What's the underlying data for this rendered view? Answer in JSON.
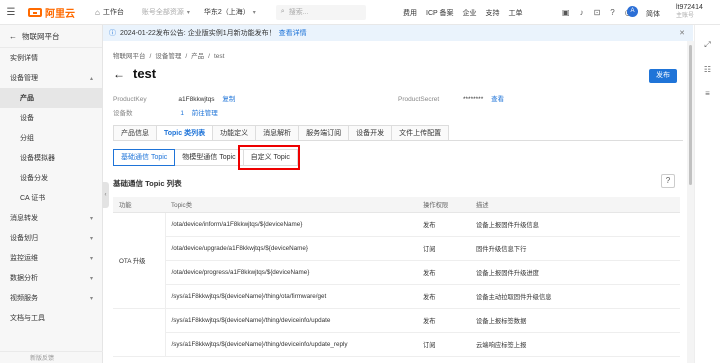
{
  "topbar": {
    "logo_text": "阿里云",
    "workbench": "工作台",
    "resource_group": "账号全部资源",
    "region": "华东2（上海）",
    "search_placeholder": "搜索...",
    "nav": [
      "费用",
      "ICP 备案",
      "企业",
      "支持",
      "工单"
    ],
    "avatar_initial": "A",
    "language": "简体",
    "user_name": "lt972414",
    "user_sub": "主账号"
  },
  "sidebar": {
    "header": "物联网平台",
    "items": [
      {
        "label": "实例详情",
        "level": 0,
        "expandable": false
      },
      {
        "label": "设备管理",
        "level": 0,
        "expandable": true,
        "expanded": true
      },
      {
        "label": "产品",
        "level": 1,
        "active": true
      },
      {
        "label": "设备",
        "level": 1
      },
      {
        "label": "分组",
        "level": 1
      },
      {
        "label": "设备模拟器",
        "level": 1
      },
      {
        "label": "设备分发",
        "level": 1
      },
      {
        "label": "CA 证书",
        "level": 1
      },
      {
        "label": "消息转发",
        "level": 0,
        "expandable": true
      },
      {
        "label": "设备划归",
        "level": 0,
        "expandable": true
      },
      {
        "label": "监控运维",
        "level": 0,
        "expandable": true
      },
      {
        "label": "数据分析",
        "level": 0,
        "expandable": true
      },
      {
        "label": "视频服务",
        "level": 0,
        "expandable": true
      },
      {
        "label": "文档与工具",
        "level": 0,
        "expandable": false
      }
    ],
    "footer": "新版反馈"
  },
  "notice": {
    "text": "2024-01-22发布公告: 企业版实例1月新功能发布！",
    "link": "查看详情"
  },
  "breadcrumb": [
    "物联网平台",
    "/",
    "设备管理",
    "/",
    "产品",
    "/",
    "test"
  ],
  "page": {
    "title": "test",
    "publish_label": "发布",
    "product_key_label": "ProductKey",
    "product_key_value": "a1F8kkwjtqs",
    "copy_label": "复制",
    "product_secret_label": "ProductSecret",
    "product_secret_value": "********",
    "view_label": "查看",
    "device_count_label": "设备数",
    "device_count_value": "1",
    "manage_label": "前往管理"
  },
  "tabs": [
    "产品信息",
    "Topic 类列表",
    "功能定义",
    "消息解析",
    "服务端订阅",
    "设备开发",
    "文件上传配置"
  ],
  "active_tab": 1,
  "subtabs": [
    "基础通信 Topic",
    "物模型通信 Topic",
    "自定义 Topic"
  ],
  "active_subtab": 0,
  "section_title": "基础通信 Topic 列表",
  "help_label": "?",
  "table": {
    "headers": [
      "功能",
      "Topic类",
      "操作权限",
      "描述"
    ],
    "group_label": "OTA 升级",
    "rows": [
      {
        "topic": "/ota/device/inform/a1F8kkwjtqs/${deviceName}",
        "perm": "发布",
        "desc": "设备上报固件升级信息"
      },
      {
        "topic": "/ota/device/upgrade/a1F8kkwjtqs/${deviceName}",
        "perm": "订阅",
        "desc": "固件升级信息下行"
      },
      {
        "topic": "/ota/device/progress/a1F8kkwjtqs/${deviceName}",
        "perm": "发布",
        "desc": "设备上报固件升级进度"
      },
      {
        "topic": "/sys/a1F8kkwjtqs/${deviceName}/thing/ota/firmware/get",
        "perm": "发布",
        "desc": "设备主动拉取固件升级信息"
      },
      {
        "topic": "/sys/a1F8kkwjtqs/${deviceName}/thing/deviceinfo/update",
        "perm": "发布",
        "desc": "设备上报标签数据"
      },
      {
        "topic": "/sys/a1F8kkwjtqs/${deviceName}/thing/deviceinfo/update_reply",
        "perm": "订阅",
        "desc": "云端响应标签上报"
      }
    ]
  }
}
